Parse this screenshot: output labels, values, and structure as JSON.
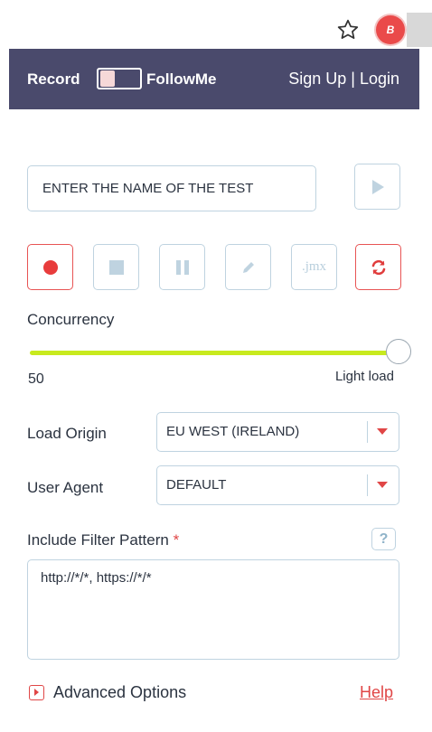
{
  "browser": {
    "star_icon": "star-outline-icon",
    "extension_icon": "blazemeter-extension-icon",
    "extension_letter": "B"
  },
  "header": {
    "record_label": "Record",
    "followme_label": "FollowMe",
    "signup_label": "Sign Up",
    "separator": "|",
    "login_label": "Login",
    "background_color": "#4a4a6c"
  },
  "test": {
    "name_placeholder": "ENTER THE NAME OF THE TEST",
    "name_value": ""
  },
  "toolbar": {
    "buttons": [
      {
        "name": "record",
        "icon": "record-dot-icon"
      },
      {
        "name": "stop",
        "icon": "stop-square-icon"
      },
      {
        "name": "pause",
        "icon": "pause-icon"
      },
      {
        "name": "edit",
        "icon": "pencil-icon"
      },
      {
        "name": "jmx",
        "label": ".jmx"
      },
      {
        "name": "sync",
        "icon": "refresh-icon"
      }
    ]
  },
  "concurrency": {
    "label": "Concurrency",
    "value": "50",
    "load_label": "Light load",
    "slider_level_percent": 100,
    "track_color": "#c8ea1e"
  },
  "load_origin": {
    "label": "Load Origin",
    "selected": "EU WEST (IRELAND)"
  },
  "user_agent": {
    "label": "User Agent",
    "selected": "DEFAULT"
  },
  "filter": {
    "label": "Include Filter Pattern",
    "required_marker": "*",
    "help_glyph": "?",
    "value": "http://*/*, https://*/*"
  },
  "footer": {
    "advanced_label": "Advanced Options",
    "help_label": "Help"
  },
  "colors": {
    "accent_red": "#e04646",
    "border_blue": "#bfd3e0"
  }
}
